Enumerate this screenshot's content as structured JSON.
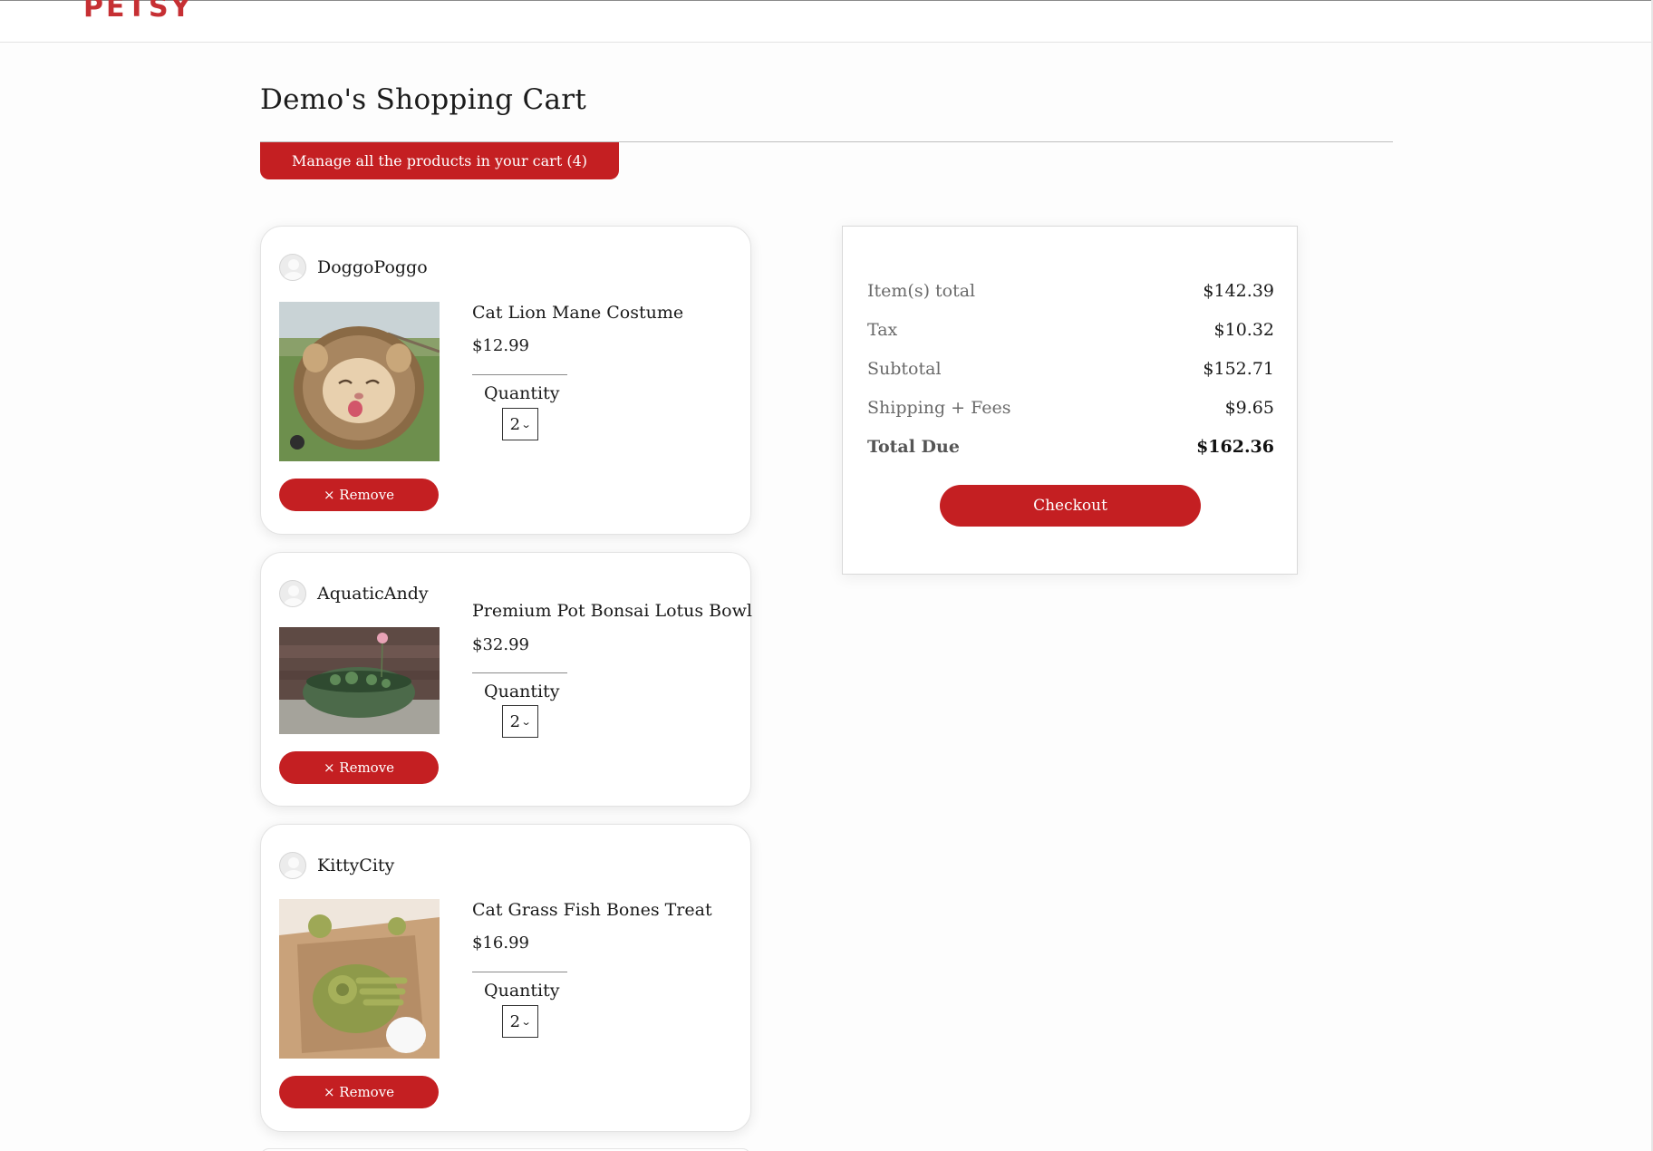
{
  "header": {
    "logo": "PETSY"
  },
  "page": {
    "title": "Demo's Shopping Cart",
    "manage_tab": "Manage all the products in your cart (4)"
  },
  "cart": {
    "quantity_label": "Quantity",
    "remove_label": "× Remove",
    "items": [
      {
        "seller": "DoggoPoggo",
        "name": "Cat Lion Mane Costume",
        "price": "$12.99",
        "quantity": "2",
        "image": "cat-lion-mane-photo"
      },
      {
        "seller": "AquaticAndy",
        "name": "Premium Pot Bonsai Lotus Bowl",
        "price": "$32.99",
        "quantity": "2",
        "image": "lotus-bowl-photo"
      },
      {
        "seller": "KittyCity",
        "name": "Cat Grass Fish Bones Treat",
        "price": "$16.99",
        "quantity": "2",
        "image": "fish-bone-treat-photo"
      }
    ]
  },
  "summary": {
    "rows": [
      {
        "label": "Item(s) total",
        "value": "$142.39"
      },
      {
        "label": "Tax",
        "value": "$10.32"
      },
      {
        "label": "Subtotal",
        "value": "$152.71"
      },
      {
        "label": "Shipping + Fees",
        "value": "$9.65"
      }
    ],
    "total": {
      "label": "Total Due",
      "value": "$162.36"
    },
    "checkout_label": "Checkout"
  },
  "colors": {
    "brand": "#c62f33",
    "button": "#c41f22"
  }
}
